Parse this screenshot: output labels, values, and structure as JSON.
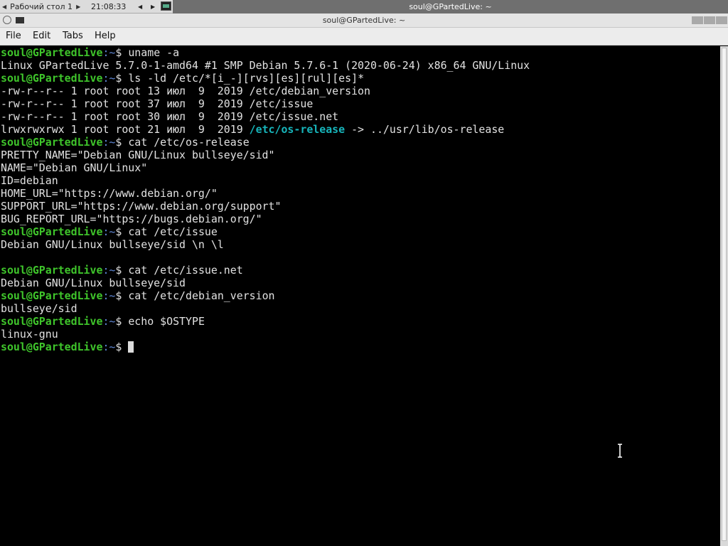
{
  "panel": {
    "workspace": "Рабочий стол 1",
    "clock": "21:08:33",
    "task_title": "soul@GPartedLive: ~"
  },
  "window": {
    "title": "soul@GPartedLive: ~"
  },
  "menu": {
    "items": [
      "File",
      "Edit",
      "Tabs",
      "Help"
    ]
  },
  "terminal": {
    "prompt_user": "soul@GPartedLive",
    "prompt_path": ":~",
    "prompt_symbol": "$",
    "lines": [
      {
        "kind": "cmd",
        "text": "uname -a"
      },
      {
        "kind": "out",
        "text": "Linux GPartedLive 5.7.0-1-amd64 #1 SMP Debian 5.7.6-1 (2020-06-24) x86_64 GNU/Linux"
      },
      {
        "kind": "cmd",
        "text": "ls -ld /etc/*[i_-][rvs][es][rul][es]*"
      },
      {
        "kind": "out",
        "text": "-rw-r--r-- 1 root root 13 июл  9  2019 /etc/debian_version"
      },
      {
        "kind": "out",
        "text": "-rw-r--r-- 1 root root 37 июл  9  2019 /etc/issue"
      },
      {
        "kind": "out",
        "text": "-rw-r--r-- 1 root root 30 июл  9  2019 /etc/issue.net"
      },
      {
        "kind": "link",
        "pre": "lrwxrwxrwx 1 root root 21 июл  9  2019 ",
        "hl": "/etc/os-release",
        "post": " -> ../usr/lib/os-release"
      },
      {
        "kind": "cmd",
        "text": "cat /etc/os-release"
      },
      {
        "kind": "out",
        "text": "PRETTY_NAME=\"Debian GNU/Linux bullseye/sid\""
      },
      {
        "kind": "out",
        "text": "NAME=\"Debian GNU/Linux\""
      },
      {
        "kind": "out",
        "text": "ID=debian"
      },
      {
        "kind": "out",
        "text": "HOME_URL=\"https://www.debian.org/\""
      },
      {
        "kind": "out",
        "text": "SUPPORT_URL=\"https://www.debian.org/support\""
      },
      {
        "kind": "out",
        "text": "BUG_REPORT_URL=\"https://bugs.debian.org/\""
      },
      {
        "kind": "cmd",
        "text": "cat /etc/issue"
      },
      {
        "kind": "out",
        "text": "Debian GNU/Linux bullseye/sid \\n \\l"
      },
      {
        "kind": "out",
        "text": ""
      },
      {
        "kind": "cmd",
        "text": "cat /etc/issue.net"
      },
      {
        "kind": "out",
        "text": "Debian GNU/Linux bullseye/sid"
      },
      {
        "kind": "cmd",
        "text": "cat /etc/debian_version"
      },
      {
        "kind": "out",
        "text": "bullseye/sid"
      },
      {
        "kind": "cmd",
        "text": "echo $OSTYPE"
      },
      {
        "kind": "out",
        "text": "linux-gnu"
      },
      {
        "kind": "active",
        "text": ""
      }
    ]
  }
}
